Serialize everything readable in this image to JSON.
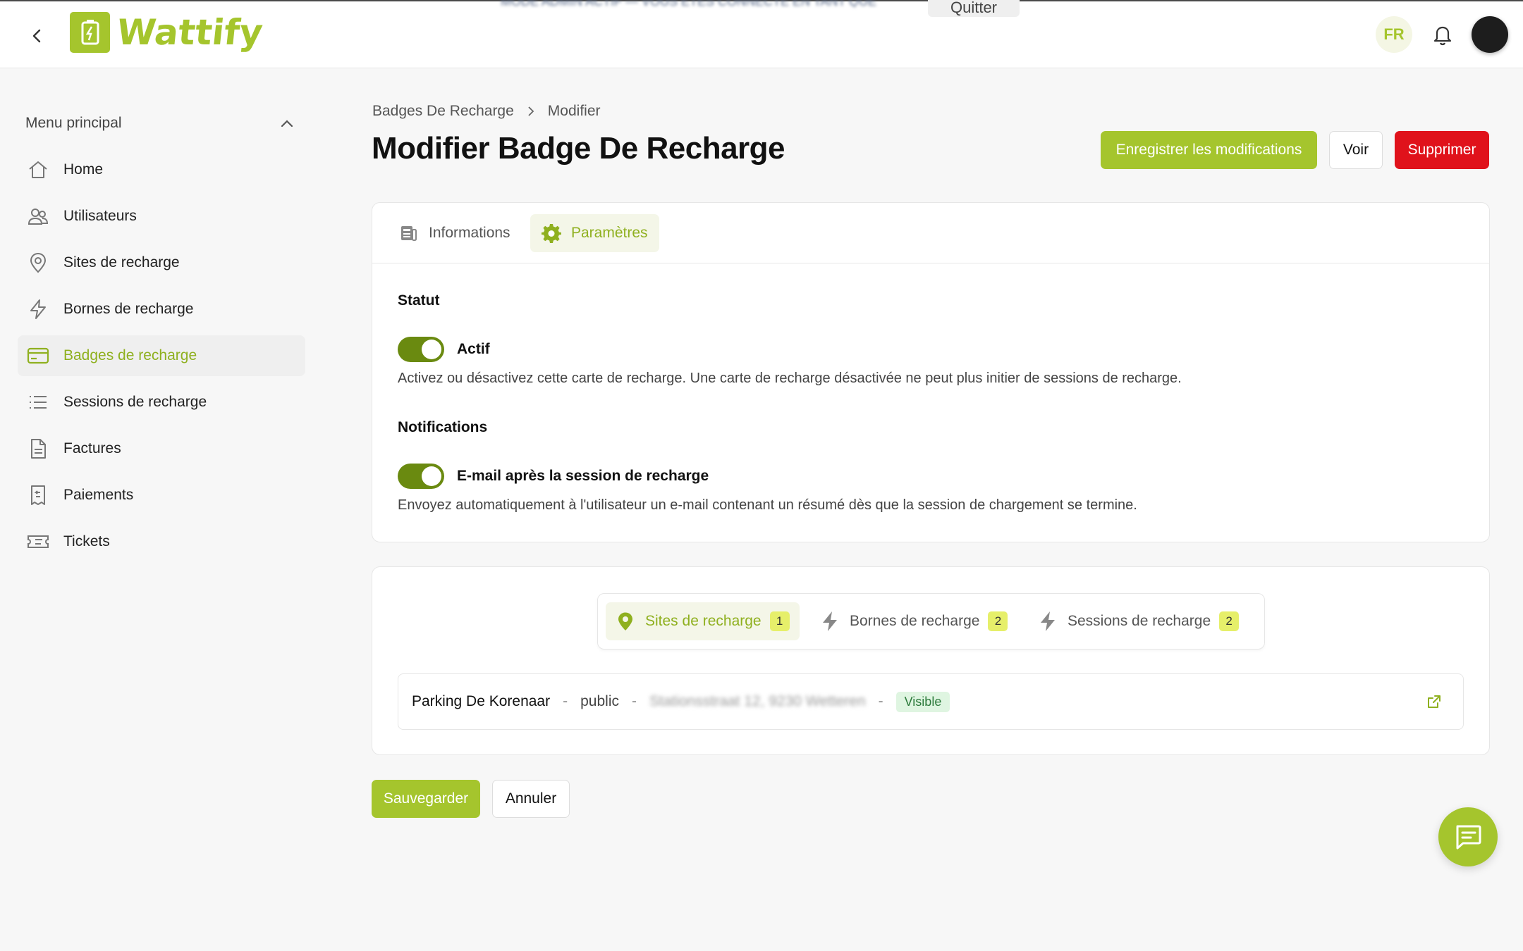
{
  "header": {
    "logo_text": "Wattify",
    "toast_text": "MODE ADMIN ACTIF — VOUS ÊTES CONNECTÉ EN TANT QUE",
    "quit_label": "Quitter",
    "lang": "FR"
  },
  "sidebar": {
    "menu_title": "Menu principal",
    "items": [
      {
        "label": "Home",
        "icon": "home-icon"
      },
      {
        "label": "Utilisateurs",
        "icon": "users-icon"
      },
      {
        "label": "Sites de recharge",
        "icon": "map-pin-icon"
      },
      {
        "label": "Bornes de recharge",
        "icon": "bolt-icon"
      },
      {
        "label": "Badges de recharge",
        "icon": "credit-card-icon",
        "active": true
      },
      {
        "label": "Sessions de recharge",
        "icon": "list-icon"
      },
      {
        "label": "Factures",
        "icon": "document-icon"
      },
      {
        "label": "Paiements",
        "icon": "receipt-icon"
      },
      {
        "label": "Tickets",
        "icon": "ticket-icon"
      }
    ]
  },
  "breadcrumb": {
    "parent": "Badges De Recharge",
    "current": "Modifier"
  },
  "page": {
    "title": "Modifier Badge De Recharge"
  },
  "actions": {
    "save_changes": "Enregistrer les modifications",
    "view": "Voir",
    "delete": "Supprimer"
  },
  "tabs": {
    "informations": "Informations",
    "parametres": "Paramètres"
  },
  "settings": {
    "status_title": "Statut",
    "active_label": "Actif",
    "active_desc": "Activez ou désactivez cette carte de recharge. Une carte de recharge désactivée ne peut plus initier de sessions de recharge.",
    "notifications_title": "Notifications",
    "email_label": "E-mail après la session de recharge",
    "email_desc": "Envoyez automatiquement à l'utilisateur un e-mail contenant un résumé dès que la session de chargement se termine."
  },
  "relations": {
    "tabs": [
      {
        "label": "Sites de recharge",
        "count": "1",
        "icon": "map-pin-icon"
      },
      {
        "label": "Bornes de recharge",
        "count": "2",
        "icon": "bolt-icon"
      },
      {
        "label": "Sessions de recharge",
        "count": "2",
        "icon": "bolt-icon"
      }
    ],
    "site": {
      "name": "Parking De Korenaar",
      "type": "public",
      "address": "Stationsstraat 12, 9230 Wetteren",
      "status": "Visible"
    }
  },
  "footer": {
    "save": "Sauvegarder",
    "cancel": "Annuler"
  },
  "colors": {
    "brand": "#a5c52d",
    "danger": "#e0121b",
    "toggle_on": "#6a8a10"
  }
}
